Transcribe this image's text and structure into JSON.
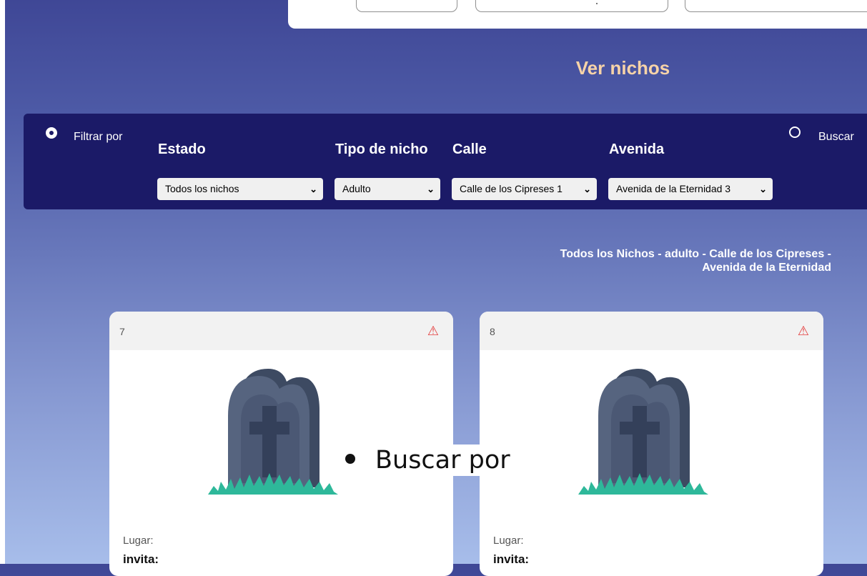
{
  "page": {
    "title": "Ver nichos"
  },
  "filters": {
    "filter_by_label": "Filtrar por",
    "search_label": "Buscar",
    "columns": {
      "estado": "Estado",
      "tipo": "Tipo de nicho",
      "calle": "Calle",
      "avenida": "Avenida"
    },
    "selects": {
      "estado": "Todos los nichos",
      "tipo": "Adulto",
      "calle": "Calle de los Cipreses 1",
      "avenida": "Avenida de la Eternidad 3"
    },
    "selected_mode": "filtrar"
  },
  "results": {
    "title_line1": "Todos los Nichos - adulto - Calle de los Cipreses -",
    "title_line2": "Avenida de la Eternidad",
    "cards": [
      {
        "number": "7",
        "lugar_label": "Lugar:",
        "invita_label": "invita:"
      },
      {
        "number": "8",
        "lugar_label": "Lugar:",
        "invita_label": "invita:"
      }
    ]
  },
  "icons": {
    "warning": "warning-triangle-icon",
    "tombstone": "tombstone-icon",
    "chevron": "chevron-down-icon"
  },
  "overlay": {
    "text": "Buscar por"
  },
  "colors": {
    "filter_bar": "#1b1a67",
    "title": "#f7d3a8",
    "warning": "#e33b3b",
    "grass": "#2eb89a"
  }
}
